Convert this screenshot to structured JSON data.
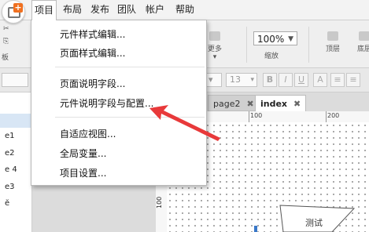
{
  "menubar": {
    "items": [
      "项目",
      "布局",
      "发布",
      "团队",
      "帐户",
      "帮助"
    ]
  },
  "toolbar": {
    "zoom_value": "100%",
    "zoom_label": "缩放",
    "more_label": "更多▾",
    "top_label": "顶层",
    "bottom_label": "底层",
    "left_label": "板"
  },
  "formatbar": {
    "font_size": "13",
    "bold": "B",
    "italic": "I",
    "underline": "U"
  },
  "dropdown": {
    "items": [
      "元件样式编辑...",
      "页面样式编辑...",
      "页面说明字段...",
      "元件说明字段与配置...",
      "自适应视图...",
      "全局变量...",
      "项目设置..."
    ]
  },
  "left_panel": {
    "pages": [
      "e1",
      "e2",
      "e 4",
      "e3",
      "ĕ"
    ]
  },
  "tabs": [
    {
      "label": "page2"
    },
    {
      "label": "index"
    }
  ],
  "canvas": {
    "ruler_top": [
      "100",
      "200"
    ],
    "ruler_left": "100",
    "shape_text": "测试"
  },
  "colors": {
    "arrow": "#e8393a",
    "app_icon_accent": "#f07020"
  }
}
